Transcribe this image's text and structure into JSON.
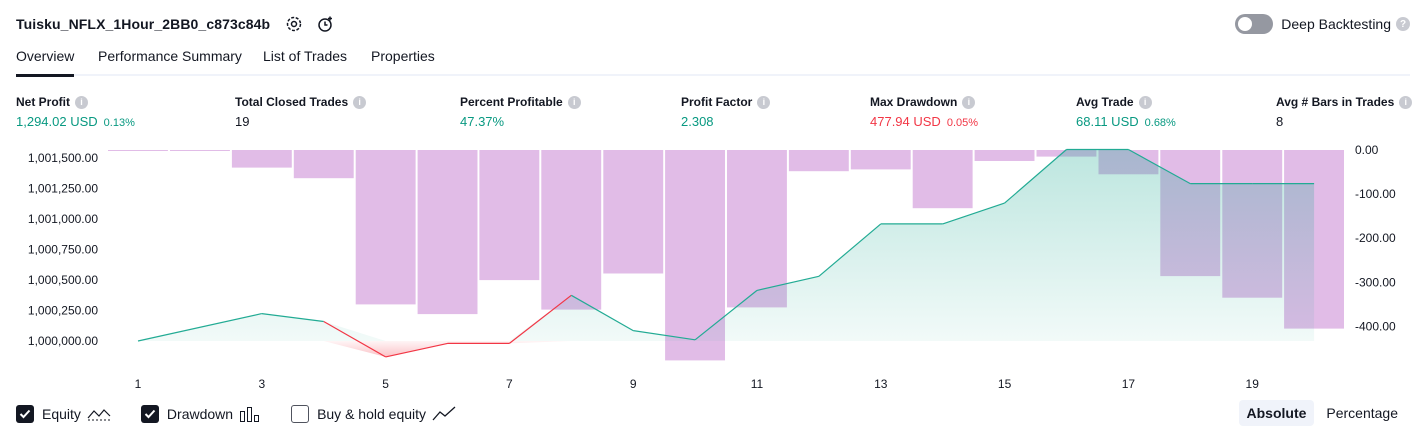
{
  "header": {
    "strategy_name": "Tuisku_NFLX_1Hour_2BB0_c873c84b",
    "deep_backtesting_label": "Deep Backtesting",
    "deep_backtesting_enabled": false
  },
  "tabs": [
    {
      "label": "Overview",
      "active": true
    },
    {
      "label": "Performance Summary",
      "active": false
    },
    {
      "label": "List of Trades",
      "active": false
    },
    {
      "label": "Properties",
      "active": false
    }
  ],
  "metrics": [
    {
      "label": "Net Profit",
      "value": "1,294.02 USD",
      "pct": "0.13%",
      "color": "green"
    },
    {
      "label": "Total Closed Trades",
      "value": "19",
      "pct": "",
      "color": "dark"
    },
    {
      "label": "Percent Profitable",
      "value": "47.37%",
      "pct": "",
      "color": "green"
    },
    {
      "label": "Profit Factor",
      "value": "2.308",
      "pct": "",
      "color": "green"
    },
    {
      "label": "Max Drawdown",
      "value": "477.94 USD",
      "pct": "0.05%",
      "color": "red"
    },
    {
      "label": "Avg Trade",
      "value": "68.11 USD",
      "pct": "0.68%",
      "color": "green"
    },
    {
      "label": "Avg # Bars in Trades",
      "value": "8",
      "pct": "",
      "color": "dark"
    }
  ],
  "chart_data": {
    "type": "line+bar",
    "x_ticks": [
      "1",
      "3",
      "5",
      "7",
      "9",
      "11",
      "13",
      "15",
      "17",
      "19"
    ],
    "y_left_ticks": [
      "1,001,500.00",
      "1,001,250.00",
      "1,001,000.00",
      "1,000,750.00",
      "1,000,500.00",
      "1,000,250.00",
      "1,000,000.00"
    ],
    "y_right_ticks": [
      "0.00",
      "-100.00",
      "-200.00",
      "-300.00",
      "-400.00"
    ],
    "equity": {
      "x": [
        1,
        3,
        4,
        5,
        6,
        7,
        8,
        9,
        10,
        11,
        12,
        13,
        14,
        15,
        16,
        17,
        18,
        19,
        20
      ],
      "values": [
        1000000,
        1000225,
        1000160,
        999870,
        999980,
        999980,
        1000375,
        1000085,
        1000010,
        1000415,
        1000530,
        1000960,
        1000960,
        1001130,
        1001570,
        1001570,
        1001290,
        1001290,
        1001290
      ]
    },
    "drawdown": {
      "x": [
        1,
        2,
        3,
        4,
        5,
        6,
        7,
        8,
        9,
        10,
        11,
        12,
        13,
        14,
        15,
        16,
        17,
        18,
        19,
        20
      ],
      "values": [
        -1,
        -1,
        -40,
        -64,
        -350,
        -372,
        -295,
        -362,
        -280,
        -477,
        -357,
        -48,
        -44,
        -132,
        -25,
        -15,
        -55,
        -286,
        -335,
        -405
      ]
    },
    "colors": {
      "equity_up": "#22ab94",
      "equity_down": "#f23645",
      "drawdown_bar": "#ce93d8",
      "axis_text": "#131722"
    }
  },
  "legend": [
    {
      "label": "Equity",
      "checked": true
    },
    {
      "label": "Drawdown",
      "checked": true
    },
    {
      "label": "Buy & hold equity",
      "checked": false
    }
  ],
  "view_modes": [
    {
      "label": "Absolute",
      "active": true
    },
    {
      "label": "Percentage",
      "active": false
    }
  ]
}
